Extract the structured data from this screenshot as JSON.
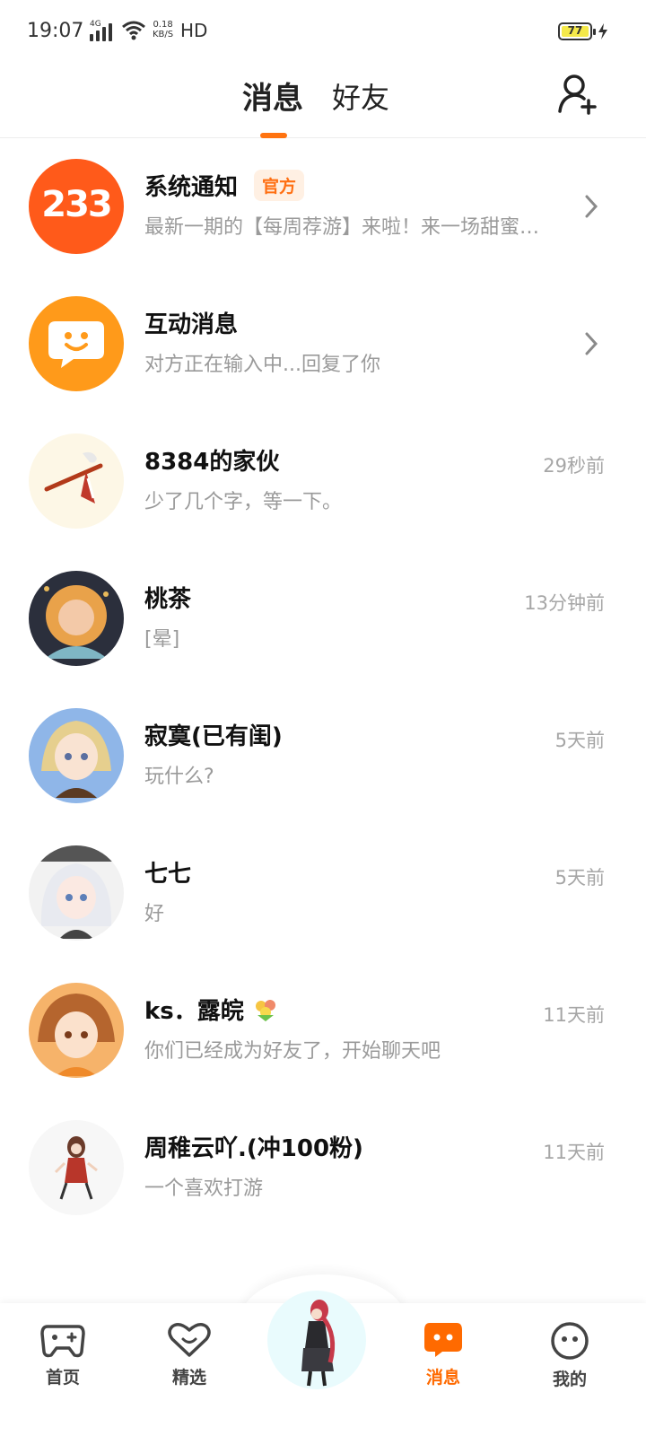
{
  "status_bar": {
    "time": "19:07",
    "network_type": "4G",
    "speed_value": "0.18",
    "speed_unit": "KB/S",
    "hd_label": "HD",
    "battery_level": "77",
    "battery_color": "#f5e94a"
  },
  "header": {
    "tabs": [
      {
        "label": "消息",
        "active": true
      },
      {
        "label": "好友",
        "active": false
      }
    ],
    "add_friend_icon": "add-user-icon",
    "accent_color": "#ff7310"
  },
  "conversations": [
    {
      "name": "系统通知",
      "badge": "官方",
      "preview": "最新一期的【每周荐游】来啦！来一场甜蜜…",
      "time": "",
      "avatar": "logo-233",
      "avatar_text": "233",
      "avatar_color": "#ff5a1a"
    },
    {
      "name": "互动消息",
      "badge": "",
      "preview": "对方正在输入中...回复了你",
      "time": "",
      "avatar": "chat-bubble-icon",
      "avatar_color": "#ff9a1a"
    },
    {
      "name": "8384的家伙",
      "badge": "",
      "preview": "少了几个字，等一下。",
      "time": "29秒前",
      "avatar": "user-avatar"
    },
    {
      "name": "桃茶",
      "badge": "",
      "preview": "[晕]",
      "time": "13分钟前",
      "avatar": "user-avatar"
    },
    {
      "name": "寂寞(已有闺)",
      "badge": "",
      "preview": "玩什么?",
      "time": "5天前",
      "avatar": "user-avatar"
    },
    {
      "name": "七七",
      "badge": "",
      "preview": "好",
      "time": "5天前",
      "avatar": "user-avatar"
    },
    {
      "name": "ks．露皖",
      "badge": "",
      "preview": "你们已经成为好友了，开始聊天吧",
      "time": "11天前",
      "avatar": "user-avatar"
    },
    {
      "name": "周稚云吖.(冲100粉)",
      "badge": "",
      "preview": "一个喜欢打游",
      "time": "11天前",
      "avatar": "user-avatar"
    }
  ],
  "bottom_nav": {
    "items": [
      {
        "label": "首页",
        "icon": "gamepad-icon",
        "active": false
      },
      {
        "label": "精选",
        "icon": "heart-icon",
        "active": false
      },
      {
        "label": "",
        "icon": "character-avatar",
        "active": false
      },
      {
        "label": "消息",
        "icon": "message-icon",
        "active": true
      },
      {
        "label": "我的",
        "icon": "profile-icon",
        "active": false
      }
    ],
    "active_color": "#ff6a00"
  }
}
